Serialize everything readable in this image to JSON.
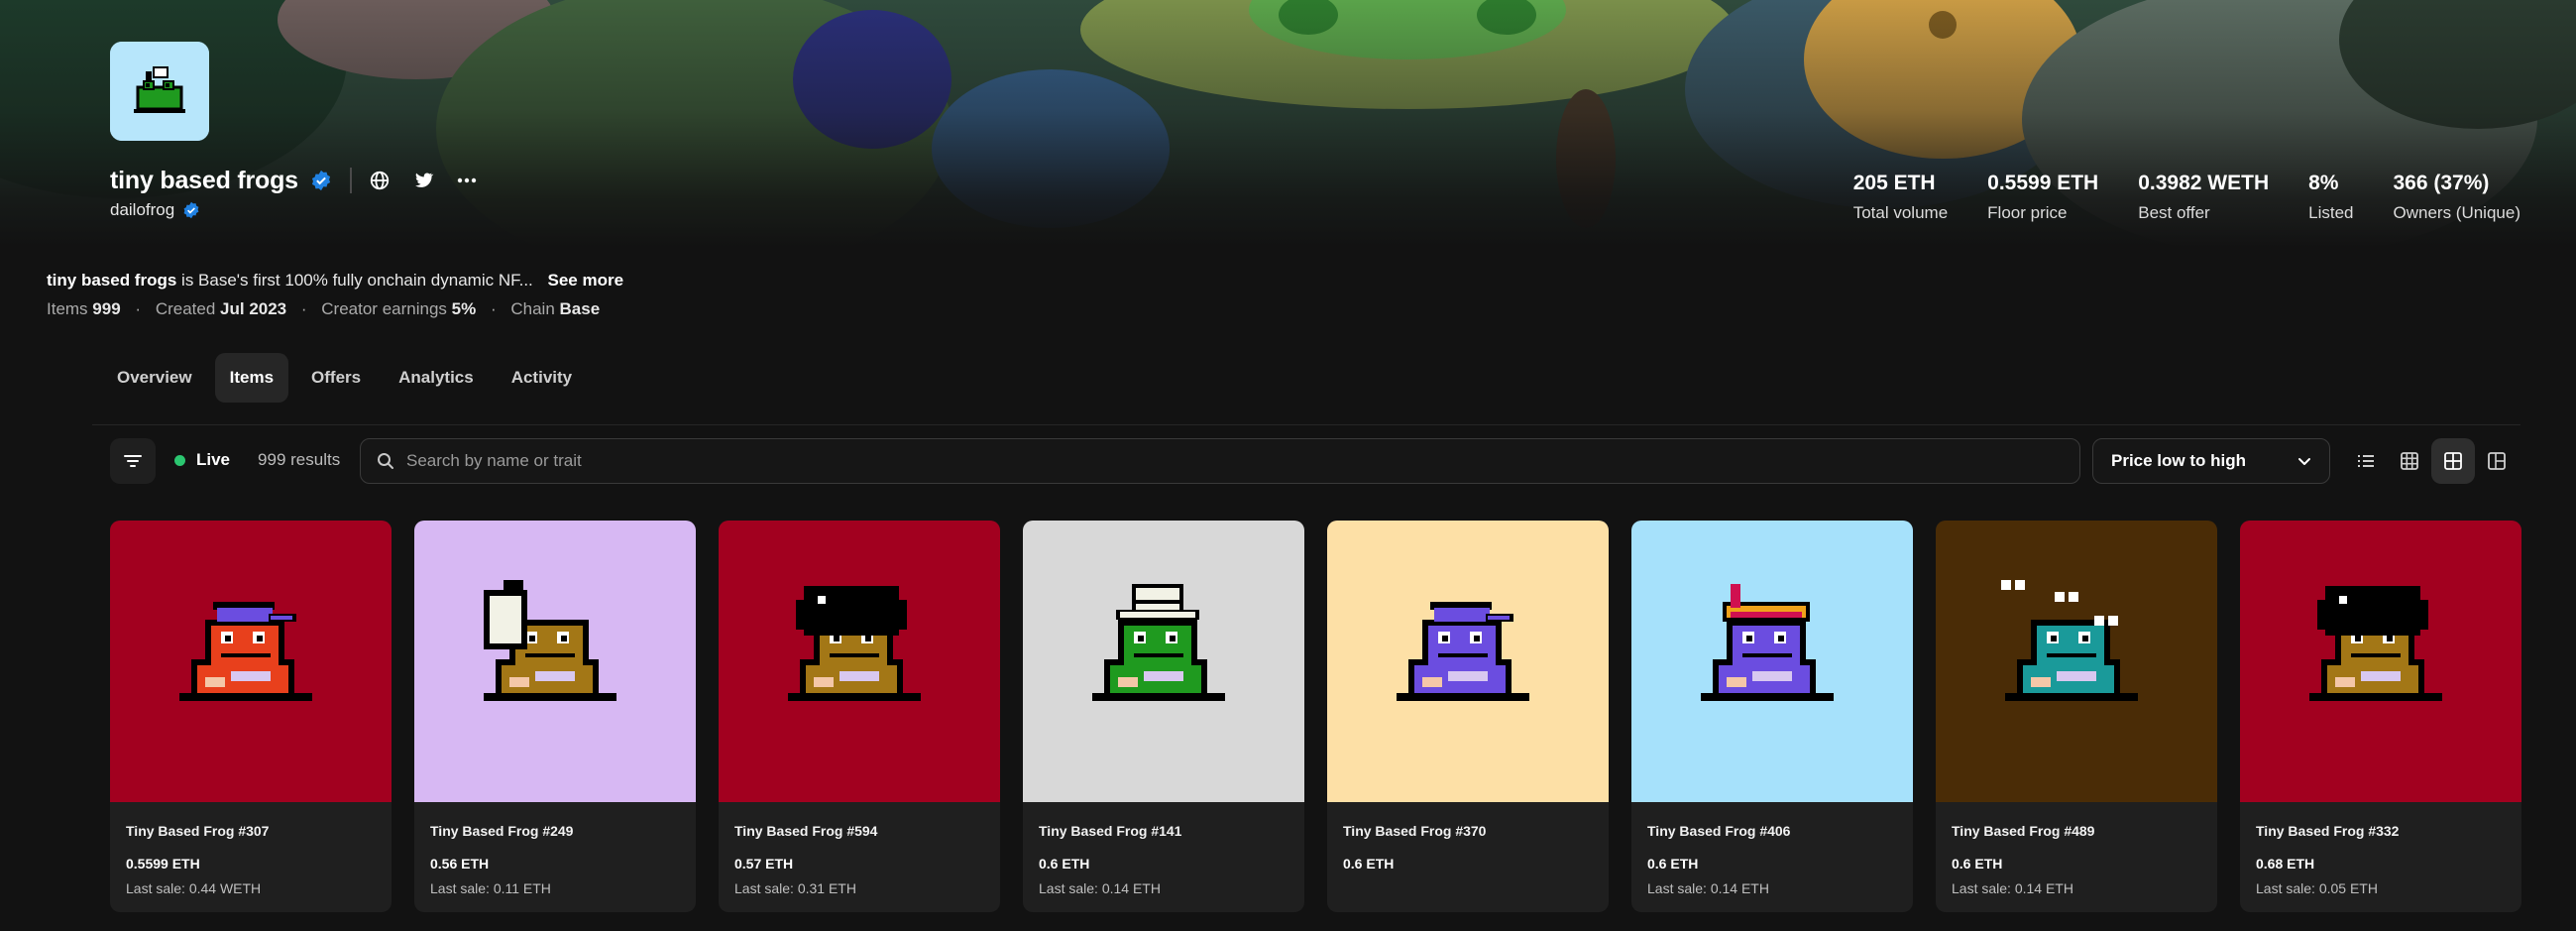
{
  "collection": {
    "name": "tiny based frogs",
    "creator": "dailofrog"
  },
  "stats": [
    {
      "value": "205 ETH",
      "label": "Total volume"
    },
    {
      "value": "0.5599 ETH",
      "label": "Floor price"
    },
    {
      "value": "0.3982 WETH",
      "label": "Best offer"
    },
    {
      "value": "8%",
      "label": "Listed"
    },
    {
      "value": "366 (37%)",
      "label": "Owners (Unique)"
    }
  ],
  "description": {
    "name": "tiny based frogs",
    "text": "is Base's first 100% fully onchain dynamic NF...",
    "see_more": "See more"
  },
  "meta": {
    "items_label": "Items",
    "items_value": "999",
    "created_label": "Created",
    "created_value": "Jul 2023",
    "earnings_label": "Creator earnings",
    "earnings_value": "5%",
    "chain_label": "Chain",
    "chain_value": "Base",
    "separator": "·"
  },
  "tabs": [
    {
      "label": "Overview",
      "active": false
    },
    {
      "label": "Items",
      "active": true
    },
    {
      "label": "Offers",
      "active": false
    },
    {
      "label": "Analytics",
      "active": false
    },
    {
      "label": "Activity",
      "active": false
    }
  ],
  "toolbar": {
    "live_label": "Live",
    "results": "999 results",
    "search_placeholder": "Search by name or trait",
    "sort_label": "Price low to high",
    "live_color": "#2bc670"
  },
  "view_modes": [
    {
      "icon": "list-view-icon",
      "active": false
    },
    {
      "icon": "small-grid-icon",
      "active": false
    },
    {
      "icon": "large-grid-icon",
      "active": true
    },
    {
      "icon": "mixed-grid-icon",
      "active": false
    }
  ],
  "items": [
    {
      "title": "Tiny Based Frog #307",
      "price": "0.5599 ETH",
      "last_sale": "Last sale: 0.44 WETH",
      "bg": "#a2001f",
      "body": "#e8401c",
      "hat": "cap",
      "hat_color": "#6b4de0"
    },
    {
      "title": "Tiny Based Frog #249",
      "price": "0.56 ETH",
      "last_sale": "Last sale: 0.11 ETH",
      "bg": "#d7b8f3",
      "body": "#a37716",
      "hat": "wings",
      "hat_color": "#f2f2e6"
    },
    {
      "title": "Tiny Based Frog #594",
      "price": "0.57 ETH",
      "last_sale": "Last sale: 0.31 ETH",
      "bg": "#a2001f",
      "body": "#a37716",
      "hat": "afro",
      "hat_color": "#000000"
    },
    {
      "title": "Tiny Based Frog #141",
      "price": "0.6 ETH",
      "last_sale": "Last sale: 0.14 ETH",
      "bg": "#d8d8d8",
      "body": "#1f9a1f",
      "hat": "safari",
      "hat_color": "#f2f2e6"
    },
    {
      "title": "Tiny Based Frog #370",
      "price": "0.6 ETH",
      "last_sale": "",
      "bg": "#fde0a6",
      "body": "#6b4de0",
      "hat": "cap",
      "hat_color": "#6b4de0"
    },
    {
      "title": "Tiny Based Frog #406",
      "price": "0.6 ETH",
      "last_sale": "Last sale: 0.14 ETH",
      "bg": "#a6e1fb",
      "body": "#6b4de0",
      "hat": "pirate",
      "hat_color": "#f0a21a"
    },
    {
      "title": "Tiny Based Frog #489",
      "price": "0.6 ETH",
      "last_sale": "Last sale: 0.14 ETH",
      "bg": "#4a2c06",
      "body": "#1a9a9a",
      "hat": "flies",
      "hat_color": "#ffffff"
    },
    {
      "title": "Tiny Based Frog #332",
      "price": "0.68 ETH",
      "last_sale": "Last sale: 0.05 ETH",
      "bg": "#a2001f",
      "body": "#a37716",
      "hat": "afro",
      "hat_color": "#000000"
    }
  ],
  "colors": {
    "background": "#121212",
    "panel": "#1f1f1f",
    "verified": "#2081e2",
    "logo_bg": "#b7e6fb"
  }
}
